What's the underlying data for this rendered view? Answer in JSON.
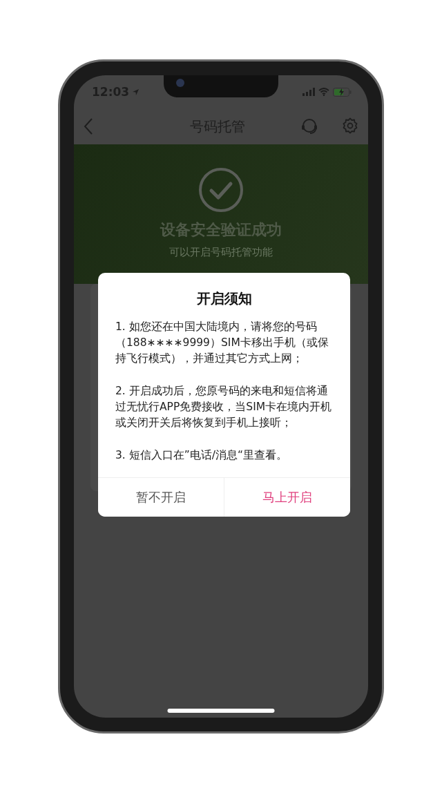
{
  "status_bar": {
    "time": "12:03"
  },
  "nav": {
    "title": "号码托管"
  },
  "header": {
    "title": "设备安全验证成功",
    "subtitle": "可以开启号码托管功能"
  },
  "dialog": {
    "title": "开启须知",
    "paragraphs": [
      "1. 如您还在中国大陆境内，请将您的号码（188∗∗∗∗9999）SIM卡移出手机（或保持飞行模式），并通过其它方式上网；",
      "2. 开启成功后，您原号码的来电和短信将通过无忧行APP免费接收，当SIM卡在境内开机或关闭开关后将恢复到手机上接听；",
      "3. 短信入口在”电话/消息“里查看。"
    ],
    "buttons": [
      {
        "label": "暂不开启",
        "kind": "secondary"
      },
      {
        "label": "马上开启",
        "kind": "primary"
      }
    ]
  }
}
